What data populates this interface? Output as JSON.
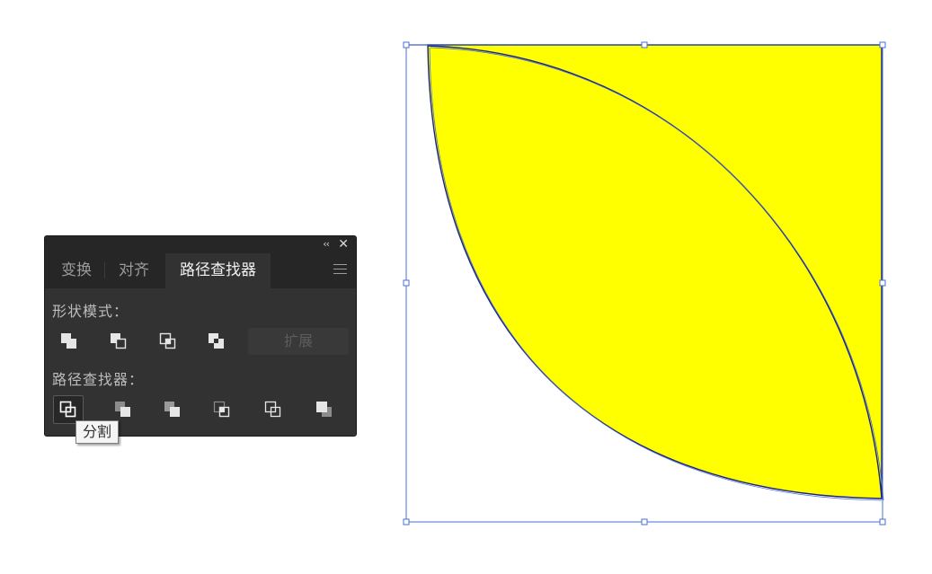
{
  "panel": {
    "tabs": [
      {
        "label": "变换"
      },
      {
        "label": "对齐"
      },
      {
        "label": "路径查找器",
        "active": true
      }
    ],
    "collapse_glyph": "‹‹",
    "close_glyph": "✕",
    "shape_modes": {
      "label": "形状模式：",
      "buttons": [
        "unite-icon",
        "minus-front-icon",
        "intersect-icon",
        "exclude-icon"
      ],
      "expand_label": "扩展"
    },
    "pathfinders": {
      "label": "路径查找器：",
      "buttons": [
        "divide-icon",
        "trim-icon",
        "merge-icon",
        "crop-icon",
        "outline-icon",
        "minus-back-icon"
      ]
    },
    "tooltip": "分割"
  },
  "canvas": {
    "fill_color": "#ffff00",
    "stroke_color": "#1a237e",
    "selection_color": "#4a6fd4"
  }
}
